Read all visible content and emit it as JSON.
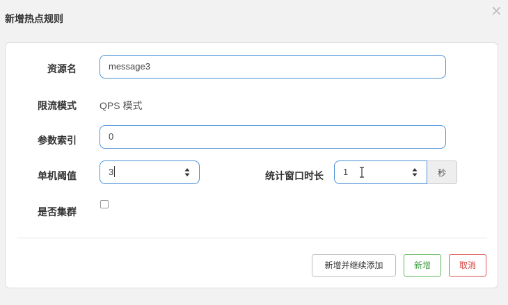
{
  "dialog": {
    "title": "新增热点规则",
    "close_glyph": "×"
  },
  "form": {
    "resource_name": {
      "label": "资源名",
      "value": "message3"
    },
    "limit_mode": {
      "label": "限流模式",
      "value": "QPS 模式"
    },
    "param_index": {
      "label": "参数索引",
      "value": "0"
    },
    "threshold": {
      "label": "单机阈值",
      "value": "3"
    },
    "window": {
      "label": "统计窗口时长",
      "value": "1",
      "unit": "秒"
    },
    "cluster": {
      "label": "是否集群",
      "checked": false
    }
  },
  "buttons": {
    "add_continue": "新增并继续添加",
    "add": "新增",
    "cancel": "取消"
  },
  "colors": {
    "input_border": "#4a90d9",
    "success": "#5cb85c",
    "danger": "#d9534f"
  }
}
